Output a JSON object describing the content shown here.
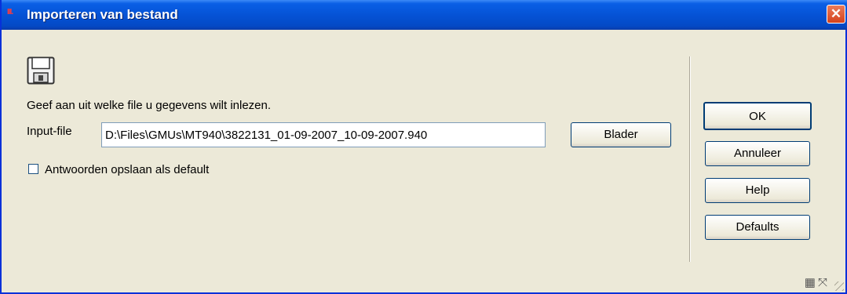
{
  "window": {
    "app_icon_text": "III.",
    "title": "Importeren van bestand",
    "close_symbol": "✕"
  },
  "icons": {
    "header_icon": "floppy-disk-icon"
  },
  "form": {
    "instruction": "Geef aan uit welke file u gegevens wilt inlezen.",
    "input_label": "Input-file",
    "input_value": "D:\\Files\\GMUs\\MT940\\3822131_01-09-2007_10-09-2007.940",
    "browse_label": "Blader",
    "checkbox_label": "Antwoorden opslaan als default",
    "checkbox_checked": false
  },
  "buttons": {
    "ok": "OK",
    "cancel": "Annuleer",
    "help": "Help",
    "defaults": "Defaults"
  },
  "statusbar": {
    "keyboard_icon": "▦",
    "expand_icon": "⤧"
  },
  "colors": {
    "titlebar": "#0553d6",
    "close_button": "#d6421c",
    "dialog_background": "#ece9d8"
  }
}
